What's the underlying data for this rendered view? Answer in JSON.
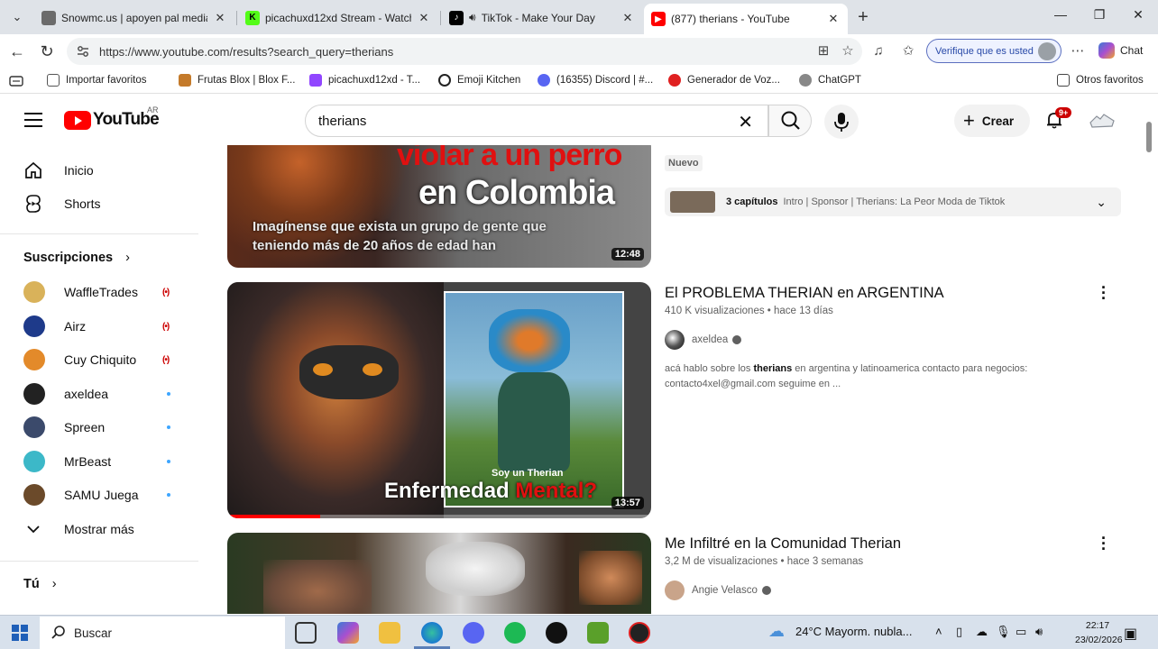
{
  "browser": {
    "tabs": [
      {
        "title": "Snowmc.us | apoyen pal media u",
        "icon": "generic-page-icon",
        "color": "#6b6b6b"
      },
      {
        "title": "picachuxd12xd Stream - Watch Li",
        "icon": "kick-icon",
        "color": "#53fc18"
      },
      {
        "title": "TikTok - Make Your Day",
        "icon": "tiktok-icon",
        "color": "#000000"
      },
      {
        "title": "(877) therians - YouTube",
        "icon": "youtube-icon",
        "color": "#ff0000"
      }
    ],
    "url": "https://www.youtube.com/results?search_query=therians",
    "verify_label": "Verifique que es usted",
    "chat_label": "Chat",
    "bookmarks": [
      {
        "label": "Importar favoritos",
        "icon": "import-icon"
      },
      {
        "label": "Frutas Blox | Blox F...",
        "icon": "blox-fruits-icon"
      },
      {
        "label": "picachuxd12xd - T...",
        "icon": "twitch-icon"
      },
      {
        "label": "Emoji Kitchen",
        "icon": "search-icon"
      },
      {
        "label": "(16355) Discord | #...",
        "icon": "discord-icon"
      },
      {
        "label": "Generador de Voz...",
        "icon": "voice-generator-icon"
      },
      {
        "label": "ChatGPT",
        "icon": "chatgpt-icon"
      }
    ],
    "other_bookmarks": "Otros favoritos"
  },
  "youtube": {
    "logo_text": "YouTube",
    "country": "AR",
    "search_value": "therians",
    "create_label": "Crear",
    "notif_badge": "9+",
    "sidebar": {
      "home": "Inicio",
      "shorts": "Shorts",
      "subs_header": "Suscripciones",
      "subscriptions": [
        {
          "name": "WaffleTrades",
          "status": "live",
          "color": "#d9b25a"
        },
        {
          "name": "Airz",
          "status": "live",
          "color": "#1e3a8a"
        },
        {
          "name": "Cuy Chiquito",
          "status": "live",
          "color": "#e38a2a"
        },
        {
          "name": "axeldea",
          "status": "new",
          "color": "#222222"
        },
        {
          "name": "Spreen",
          "status": "new",
          "color": "#3b4a6b"
        },
        {
          "name": "MrBeast",
          "status": "new",
          "color": "#3cb8c8"
        },
        {
          "name": "SAMU Juega",
          "status": "new",
          "color": "#6b4a2a"
        }
      ],
      "show_more": "Mostrar más",
      "you_header": "Tú"
    },
    "results": [
      {
        "thumb_text_1": "violar a un perro",
        "thumb_text_2": "en Colombia",
        "thumb_caption": "Imagínense que exista un grupo de gente que teniendo más de 20 años de edad han",
        "duration": "12:48",
        "badge": "Nuevo",
        "chapters_count": "3 capítulos",
        "chapters_text": "Intro | Sponsor | Therians: La Peor Moda de Tiktok"
      },
      {
        "title": "El PROBLEMA THERIAN en ARGENTINA",
        "views": "410 K visualizaciones",
        "age": "hace 13 días",
        "channel": "axeldea",
        "desc_pre": "acá hablo sobre los ",
        "desc_bold": "therians",
        "desc_post": " en argentina y latinoamerica contacto para negocios: contacto4xel@gmail.com seguime en ...",
        "thumb_text_small": "Soy un Therian",
        "thumb_text_white": "Enfermedad ",
        "thumb_text_red": "Mental?",
        "duration": "13:57",
        "progress": 0.22
      },
      {
        "title": "Me Infiltré en la Comunidad Therian",
        "views": "3,2 M de visualizaciones",
        "age": "hace 3 semanas",
        "channel": "Angie Velasco"
      }
    ]
  },
  "taskbar": {
    "search_label": "Buscar",
    "weather": "24°C Mayorm. nubla...",
    "time": "22:17",
    "date": "23/02/2026"
  }
}
